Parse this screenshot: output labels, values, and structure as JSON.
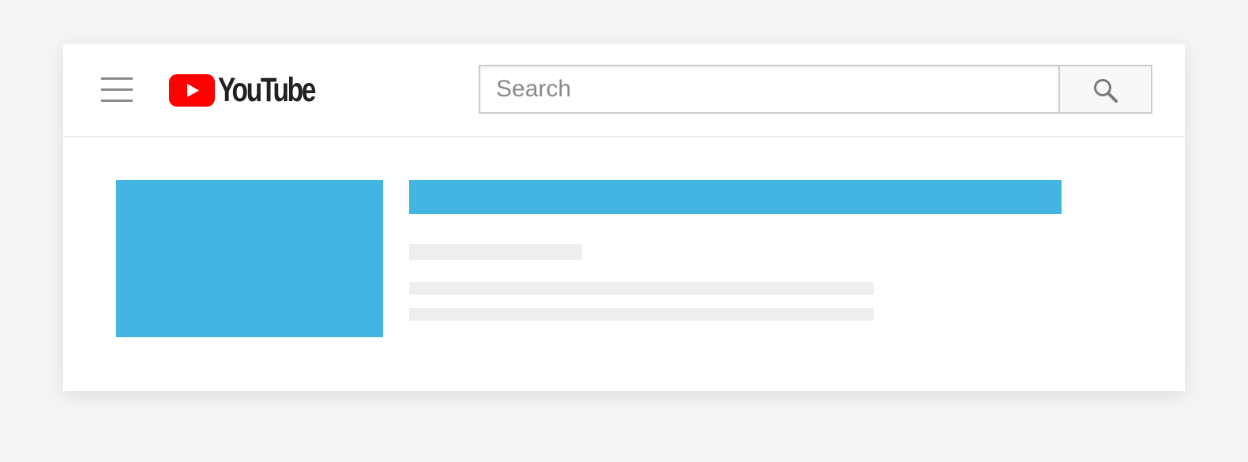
{
  "header": {
    "logo_text": "YouTube",
    "logo_icon": "youtube-play-logo-icon",
    "menu_icon": "hamburger-menu-icon",
    "brand_color": "#ff0000"
  },
  "search": {
    "placeholder": "Search",
    "value": "",
    "button_icon": "search-icon"
  },
  "video_placeholder": {
    "thumbnail_color": "#42b5e2",
    "title_color": "#42b5e2",
    "skeleton_color": "#eeeeee"
  }
}
